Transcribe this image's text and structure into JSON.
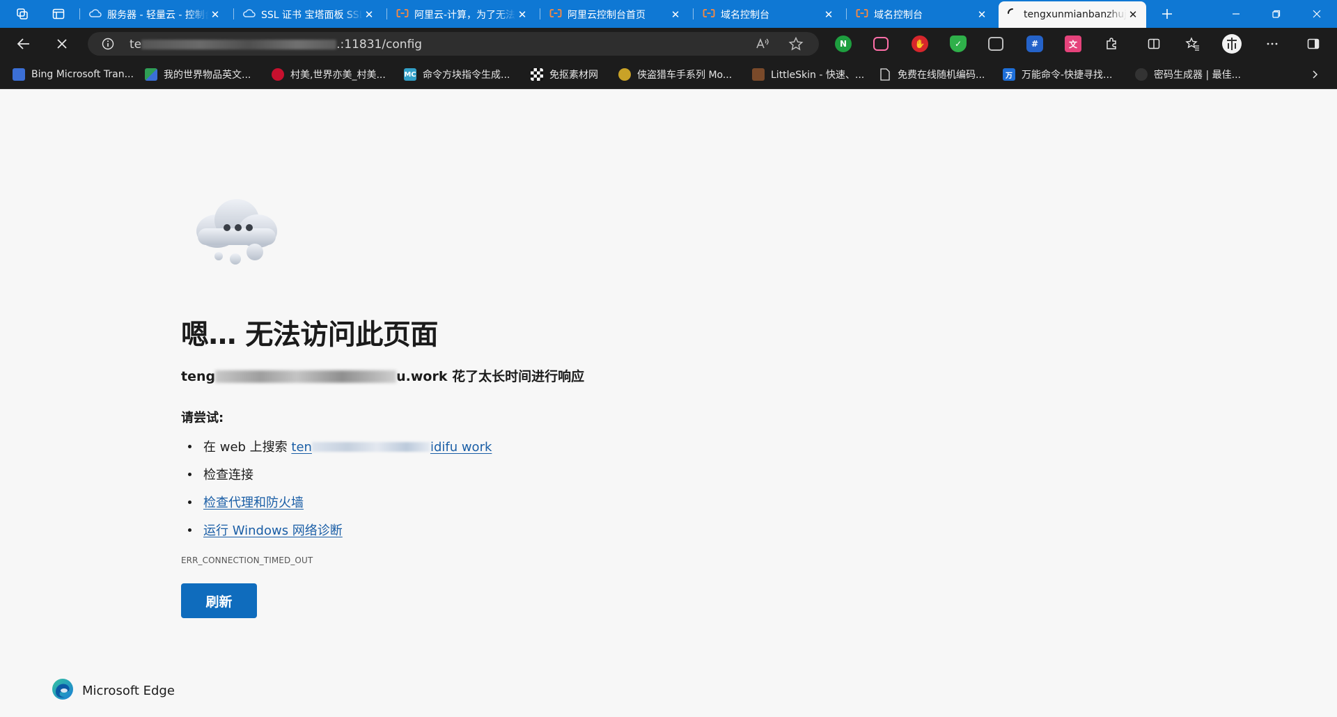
{
  "tabs": [
    {
      "title": "服务器 - 轻量云 - 控制台",
      "icon": "cloud-icon"
    },
    {
      "title": "SSL 证书 宝塔面板 SSL",
      "icon": "cloud-icon"
    },
    {
      "title": "阿里云-计算，为了无法计算的价值",
      "icon": "aliyun-icon"
    },
    {
      "title": "阿里云控制台首页",
      "icon": "aliyun-icon"
    },
    {
      "title": "域名控制台",
      "icon": "aliyun-icon"
    },
    {
      "title": "域名控制台",
      "icon": "aliyun-icon"
    },
    {
      "title": "tengxunmianbanzhuji",
      "icon": "loading-icon",
      "active": true
    }
  ],
  "address": {
    "prefix": "te",
    "suffix": ".:11831/config"
  },
  "bookmarks": [
    {
      "label": "Bing Microsoft Tran...",
      "icon": "translator-icon",
      "color": "#3b6fd6"
    },
    {
      "label": "我的世界物品英文...",
      "icon": "grid-icon",
      "color": "#2f9e55"
    },
    {
      "label": "村美,世界亦美_村美...",
      "icon": "red-logo-icon",
      "color": "#c8102e"
    },
    {
      "label": "命令方块指令生成...",
      "icon": "mc-icon",
      "color": "#32a0c8",
      "glyph": "MC"
    },
    {
      "label": "免抠素材网",
      "icon": "checker-icon",
      "color": "#ffffff"
    },
    {
      "label": "侠盗猎车手系列 Mo...",
      "icon": "gta-icon",
      "color": "#c9a227"
    },
    {
      "label": "LittleSkin - 快速、...",
      "icon": "skin-icon",
      "color": "#7a4a2a"
    },
    {
      "label": "免费在线随机编码...",
      "icon": "page-icon",
      "color": "#1c1c1c"
    },
    {
      "label": "万能命令-快捷寻找...",
      "icon": "wan-icon",
      "color": "#1e6fd9",
      "glyph": "万"
    },
    {
      "label": "密码生成器 | 最佳...",
      "icon": "lock-icon",
      "color": "#333333"
    }
  ],
  "error": {
    "title": "嗯… 无法访问此页面",
    "host_prefix": "teng",
    "host_suffix": "u.work 花了太长时间进行响应",
    "try_heading": "请尝试:",
    "suggestions": {
      "search_prefix": "在 web 上搜索 ",
      "search_link_start": "ten",
      "search_link_end": "idifu work",
      "check_connection": "检查连接",
      "proxy_firewall": "检查代理和防火墙",
      "diagnostics": "运行 Windows 网络诊断"
    },
    "code": "ERR_CONNECTION_TIMED_OUT",
    "refresh_label": "刷新"
  },
  "brand": {
    "name": "Microsoft Edge"
  },
  "colors": {
    "tabstrip": "#0f78d4",
    "toolbar": "#1c1c1c",
    "link": "#1a5ea6",
    "button": "#0f6cbd"
  }
}
